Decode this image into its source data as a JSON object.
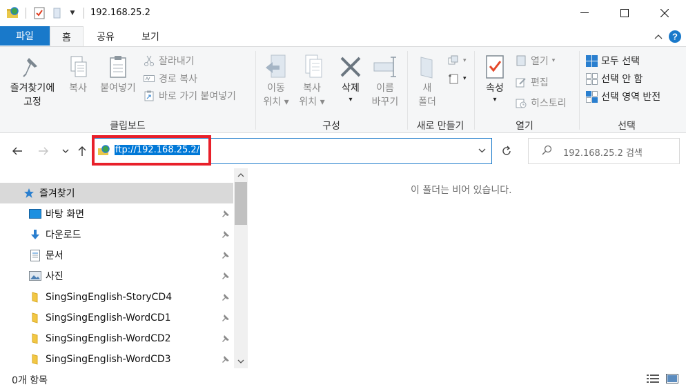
{
  "window": {
    "title": "192.168.25.2",
    "minimize_label": "—",
    "maximize_label": "☐",
    "close_label": "✕"
  },
  "tabs": {
    "file": "파일",
    "home": "홈",
    "share": "공유",
    "view": "보기",
    "collapse_label": "^",
    "help_label": "?"
  },
  "ribbon": {
    "clipboard": {
      "label": "클립보드",
      "pin_quick": [
        "즐겨찾기에",
        "고정"
      ],
      "copy": "복사",
      "paste": "붙여넣기",
      "cut": "잘라내기",
      "copy_path": "경로 복사",
      "paste_shortcut": "바로 가기 붙여넣기"
    },
    "organize": {
      "label": "구성",
      "move_to": [
        "이동",
        "위치"
      ],
      "copy_to": [
        "복사",
        "위치"
      ],
      "delete": "삭제",
      "rename": [
        "이름",
        "바꾸기"
      ]
    },
    "new": {
      "label": "새로 만들기",
      "new_folder": [
        "새",
        "폴더"
      ]
    },
    "open": {
      "label": "열기",
      "properties": "속성",
      "open": "열기",
      "edit": "편집",
      "history": "히스토리"
    },
    "select": {
      "label": "선택",
      "select_all": "모두 선택",
      "select_none": "선택 안 함",
      "invert": "선택 영역 반전"
    }
  },
  "address": {
    "value": "ftp://192.168.25.2/",
    "search_placeholder": "192.168.25.2 검색"
  },
  "nav": {
    "items": [
      {
        "label": "즐겨찾기",
        "icon": "star-icon",
        "selected": true,
        "pinned": false
      },
      {
        "label": "바탕 화면",
        "icon": "desktop-icon",
        "selected": false,
        "pinned": true
      },
      {
        "label": "다운로드",
        "icon": "download-icon",
        "selected": false,
        "pinned": true
      },
      {
        "label": "문서",
        "icon": "document-icon",
        "selected": false,
        "pinned": true
      },
      {
        "label": "사진",
        "icon": "pictures-icon",
        "selected": false,
        "pinned": true
      },
      {
        "label": "SingSingEnglish-StoryCD4",
        "icon": "folder-icon",
        "selected": false,
        "pinned": true
      },
      {
        "label": "SingSingEnglish-WordCD1",
        "icon": "folder-icon",
        "selected": false,
        "pinned": true
      },
      {
        "label": "SingSingEnglish-WordCD2",
        "icon": "folder-icon",
        "selected": false,
        "pinned": true
      },
      {
        "label": "SingSingEnglish-WordCD3",
        "icon": "folder-icon",
        "selected": false,
        "pinned": true
      }
    ]
  },
  "content": {
    "empty_message": "이 폴더는 비어 있습니다."
  },
  "status": {
    "item_count": "0개 항목"
  },
  "colors": {
    "accent": "#1979ca",
    "highlight_border": "#e8202a",
    "selection": "#0078d7"
  }
}
